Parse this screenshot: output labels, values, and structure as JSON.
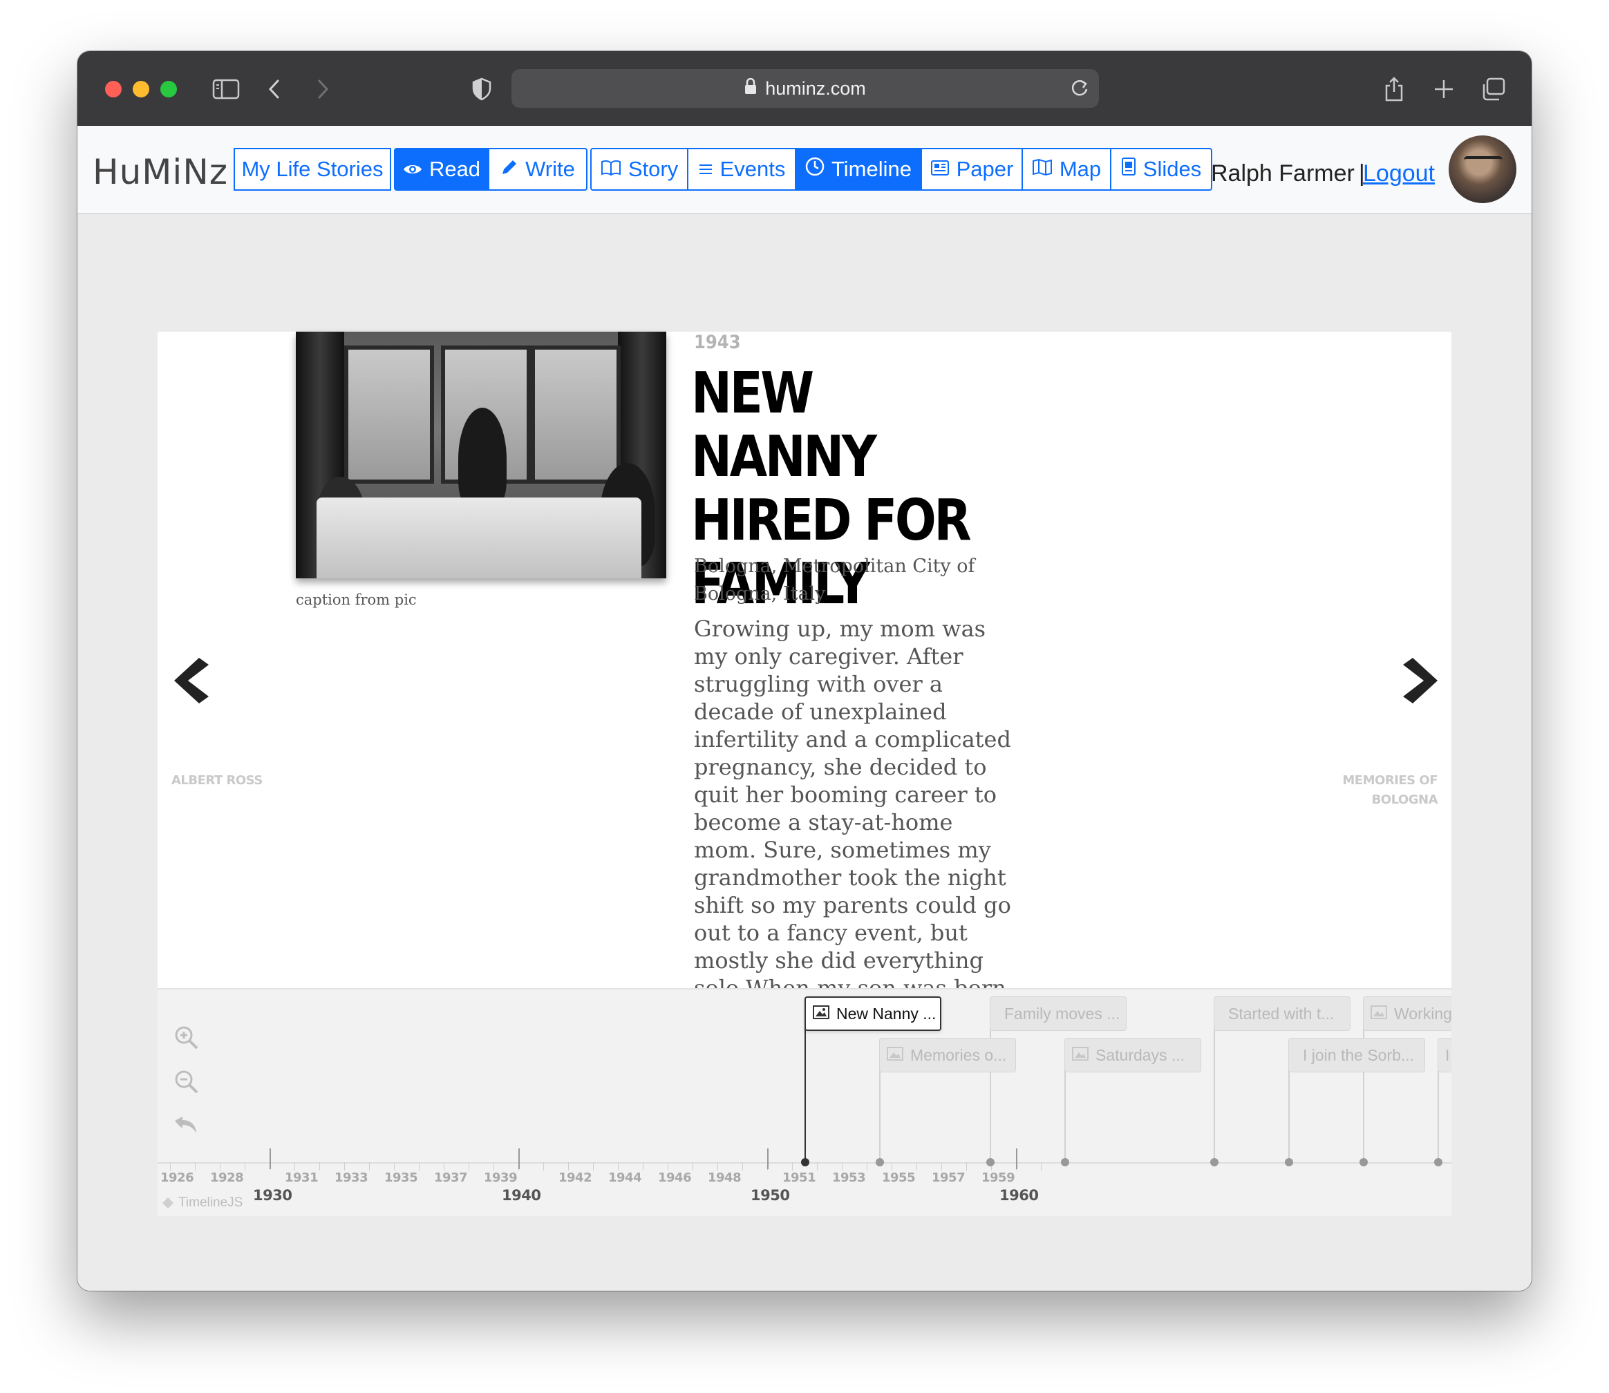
{
  "browser": {
    "url": "huminz.com"
  },
  "app": {
    "logo": "HuMiNz",
    "nav": [
      {
        "label": "My Life Stories",
        "active": false,
        "icon": ""
      },
      {
        "label": "Read",
        "active": true,
        "icon": "eye-icon"
      },
      {
        "label": "Write",
        "active": false,
        "icon": "pencil-icon"
      },
      {
        "label": "Story",
        "active": false,
        "icon": "book-icon"
      },
      {
        "label": "Events",
        "active": false,
        "icon": "list-icon"
      },
      {
        "label": "Timeline",
        "active": true,
        "icon": "clock-icon"
      },
      {
        "label": "Paper",
        "active": false,
        "icon": "newspaper-icon"
      },
      {
        "label": "Map",
        "active": false,
        "icon": "map-icon"
      },
      {
        "label": "Slides",
        "active": false,
        "icon": "slides-icon"
      }
    ],
    "user_name": "Ralph Farmer",
    "separator": "|",
    "logout_label": "Logout"
  },
  "slide": {
    "caption": "caption from pic",
    "date": "1943",
    "headline": "NEW NANNY HIRED FOR FAMILY",
    "location": "Bologna, Metropolitan City of Bologna, Italy",
    "body": "Growing up, my mom was my only caregiver. After struggling with over a decade of unexplained infertility and a complicated pregnancy, she decided to quit her booming career to become a stay-at-home mom. Sure, sometimes my grandmother took the night shift so my parents could go out to a fancy event, but mostly she did everything solo.When my son was born on a cold February afternoon, my parents were in a",
    "prev_label": "ALBERT ROSS",
    "next_label": "MEMORIES OF BOLOGNA"
  },
  "timeline": {
    "markers": [
      {
        "label": "New Nanny ...",
        "active": true
      },
      {
        "label": "Memories o...",
        "active": false
      },
      {
        "label": "Family moves ...",
        "active": false
      },
      {
        "label": "Saturdays ...",
        "active": false
      },
      {
        "label": "Started with t...",
        "active": false
      },
      {
        "label": "I join the Sorb...",
        "active": false
      },
      {
        "label": "Working",
        "active": false
      },
      {
        "label": "I",
        "active": false
      }
    ],
    "minor_years": [
      "1926",
      "1928",
      "1931",
      "1933",
      "1935",
      "1937",
      "1939",
      "1942",
      "1944",
      "1946",
      "1948",
      "1951",
      "1953",
      "1955",
      "1957",
      "1959"
    ],
    "major_years": [
      "1930",
      "1940",
      "1950",
      "1960"
    ],
    "credit": "TimelineJS"
  }
}
